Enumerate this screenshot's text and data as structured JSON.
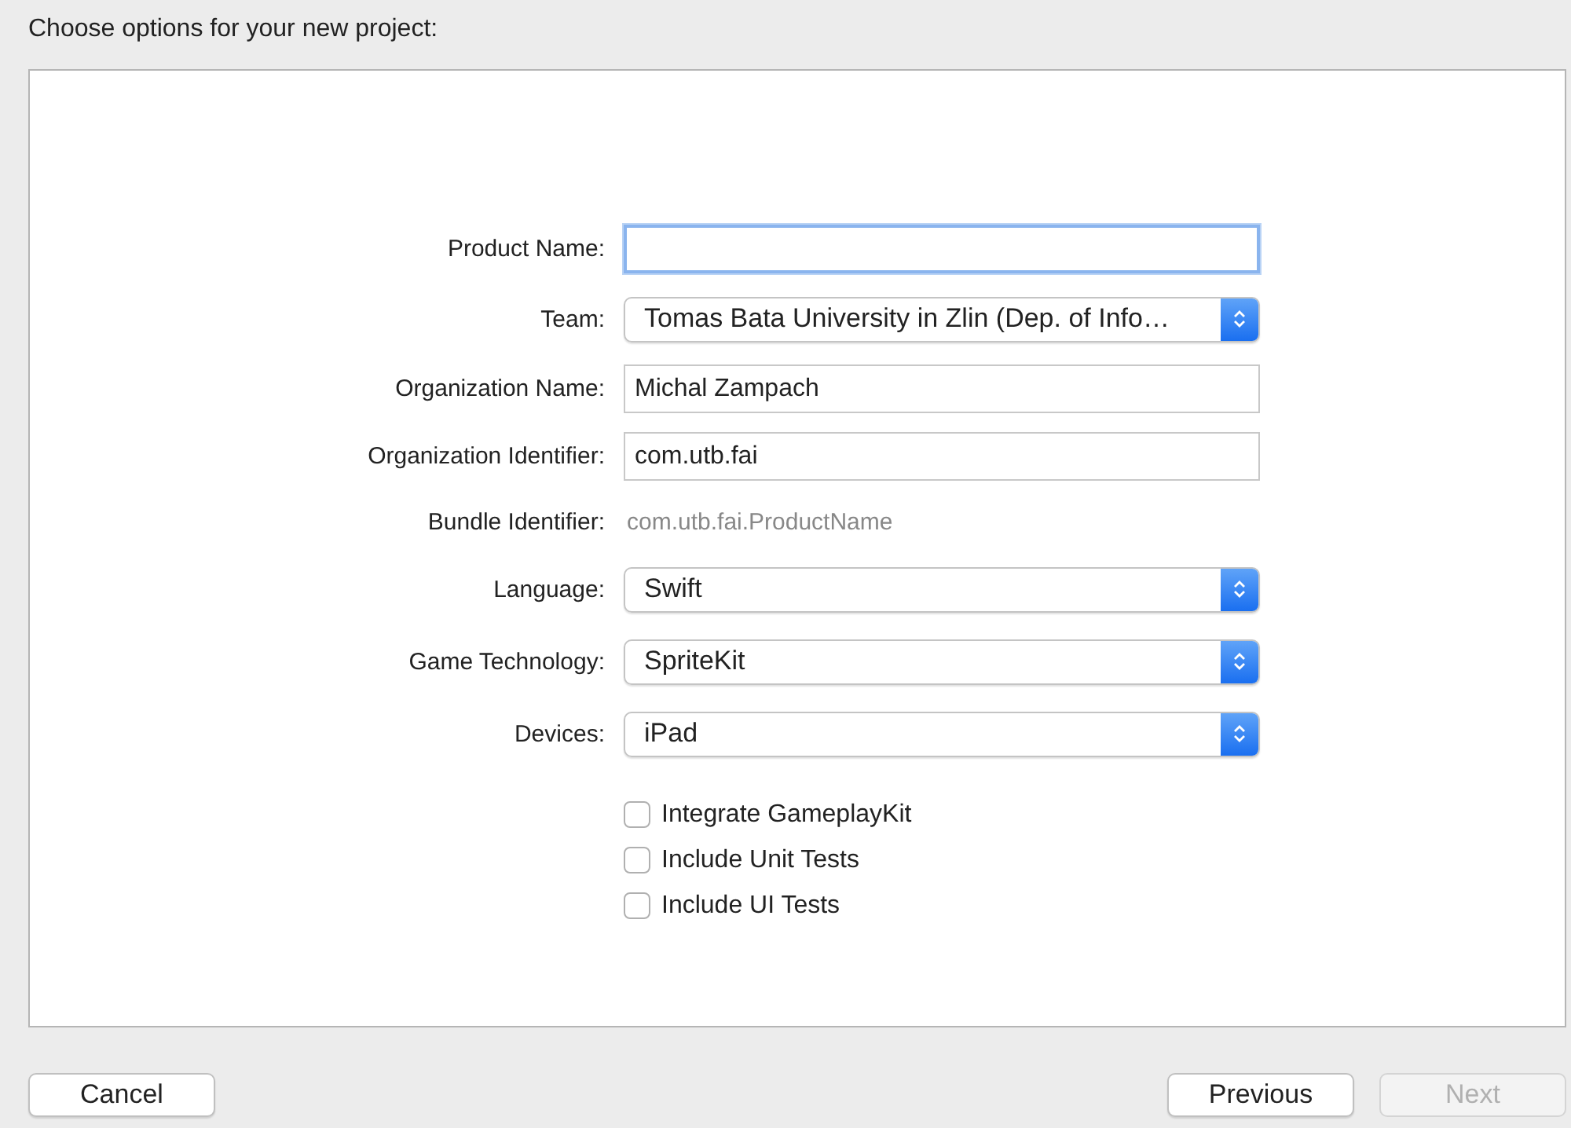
{
  "heading": "Choose options for your new project:",
  "fields": [
    {
      "label": "Product Name:",
      "kind": "text",
      "focused": true
    },
    {
      "label": "Team:",
      "kind": "popup",
      "value": "Tomas Bata University in Zlin (Dep. of Info…"
    },
    {
      "label": "Organization Name:",
      "kind": "text",
      "value": "Michal Zampach",
      "focused": false
    },
    {
      "label": "Organization Identifier:",
      "kind": "text",
      "value": "com.utb.fai",
      "focused": false
    },
    {
      "label": "Bundle Identifier:",
      "kind": "static",
      "value": "com.utb.fai.ProductName"
    },
    {
      "label": "Language:",
      "kind": "popup",
      "value": "Swift"
    },
    {
      "label": "Game Technology:",
      "kind": "popup",
      "value": "SpriteKit"
    },
    {
      "label": "Devices:",
      "kind": "popup",
      "value": "iPad"
    }
  ],
  "checkboxes": [
    {
      "label": "Integrate GameplayKit",
      "checked": false
    },
    {
      "label": "Include Unit Tests",
      "checked": false
    },
    {
      "label": "Include UI Tests",
      "checked": false
    }
  ],
  "left_buttons": [
    {
      "label": "Cancel",
      "disabled": false
    }
  ],
  "right_buttons": [
    {
      "label": "Previous",
      "disabled": false
    },
    {
      "label": "Next",
      "disabled": true
    }
  ]
}
